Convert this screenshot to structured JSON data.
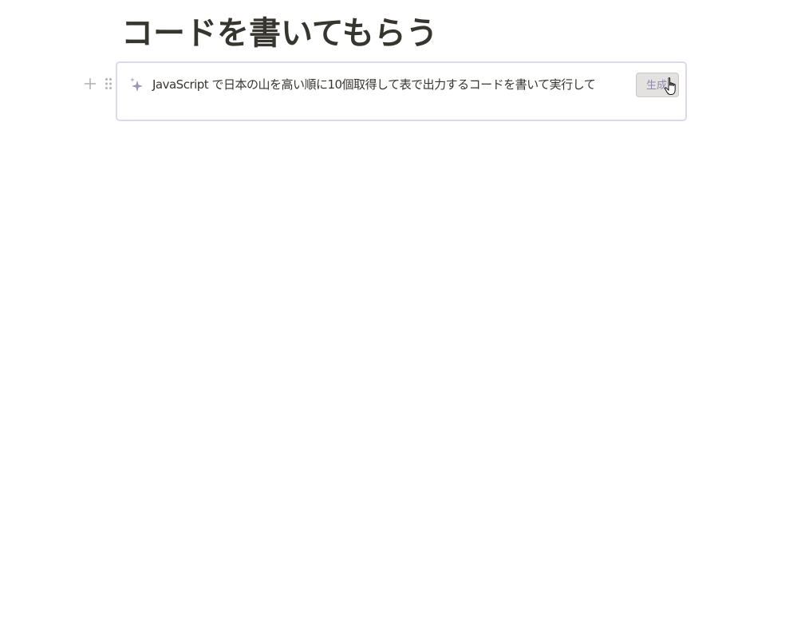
{
  "page": {
    "title": "コードを書いてもらう"
  },
  "block_handles": {
    "add_icon": "plus-icon",
    "drag_icon": "drag-handle-icon"
  },
  "ai_block": {
    "icon": "sparkle-icon",
    "prompt": "JavaScript で日本の山を高い順に10個取得して表で出力するコードを書いて実行して",
    "generate_label": "生成"
  },
  "colors": {
    "text": "#37352f",
    "block_border": "#ded8ea",
    "button_bg": "#e3e2e0",
    "button_text": "#8f8aa8",
    "handle": "#b4b3b0"
  }
}
